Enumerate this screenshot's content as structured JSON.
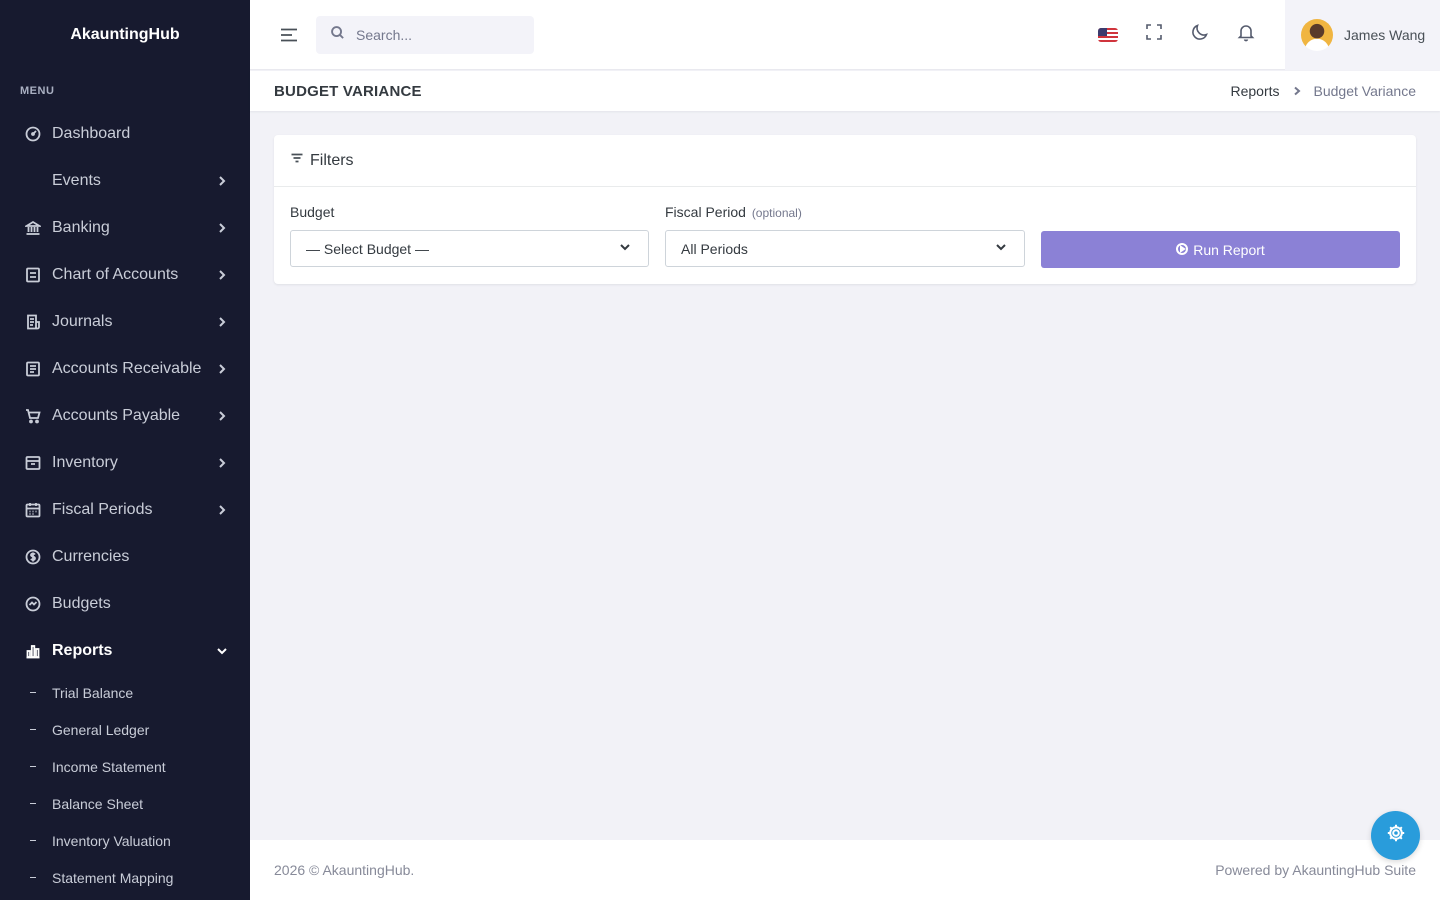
{
  "app": {
    "brand": "AkauntingHub"
  },
  "sidebar": {
    "menu_title": "MENU",
    "items": [
      {
        "label": "Dashboard",
        "icon": "gauge-icon"
      },
      {
        "label": "Events",
        "icon": ""
      },
      {
        "label": "Banking",
        "icon": "bank-icon"
      },
      {
        "label": "Chart of Accounts",
        "icon": "ledger-icon"
      },
      {
        "label": "Journals",
        "icon": "journal-icon"
      },
      {
        "label": "Accounts Receivable",
        "icon": "receivable-icon"
      },
      {
        "label": "Accounts Payable",
        "icon": "cart-icon"
      },
      {
        "label": "Inventory",
        "icon": "box-icon"
      },
      {
        "label": "Fiscal Periods",
        "icon": "calendar-icon"
      },
      {
        "label": "Currencies",
        "icon": "dollar-icon"
      },
      {
        "label": "Budgets",
        "icon": "chart-check-icon"
      },
      {
        "label": "Reports",
        "icon": "bar-chart-icon"
      }
    ],
    "report_sub_items": [
      {
        "label": "Trial Balance"
      },
      {
        "label": "General Ledger"
      },
      {
        "label": "Income Statement"
      },
      {
        "label": "Balance Sheet"
      },
      {
        "label": "Inventory Valuation"
      },
      {
        "label": "Statement Mapping"
      }
    ]
  },
  "topbar": {
    "search_placeholder": "Search...",
    "user_name": "James Wang"
  },
  "page": {
    "title": "BUDGET VARIANCE",
    "breadcrumb": {
      "parent": "Reports",
      "current": "Budget Variance"
    }
  },
  "filters": {
    "title": "Filters",
    "budget_label": "Budget",
    "budget_value": "— Select Budget —",
    "period_label": "Fiscal Period",
    "period_optional": "(optional)",
    "period_value": "All Periods",
    "run_label": "Run Report"
  },
  "footer": {
    "left": "2026 © AkauntingHub.",
    "right": "Powered by AkauntingHub Suite"
  },
  "colors": {
    "sidebar_bg": "#171a2f",
    "accent": "#8b81d6",
    "fab": "#299cdb"
  }
}
